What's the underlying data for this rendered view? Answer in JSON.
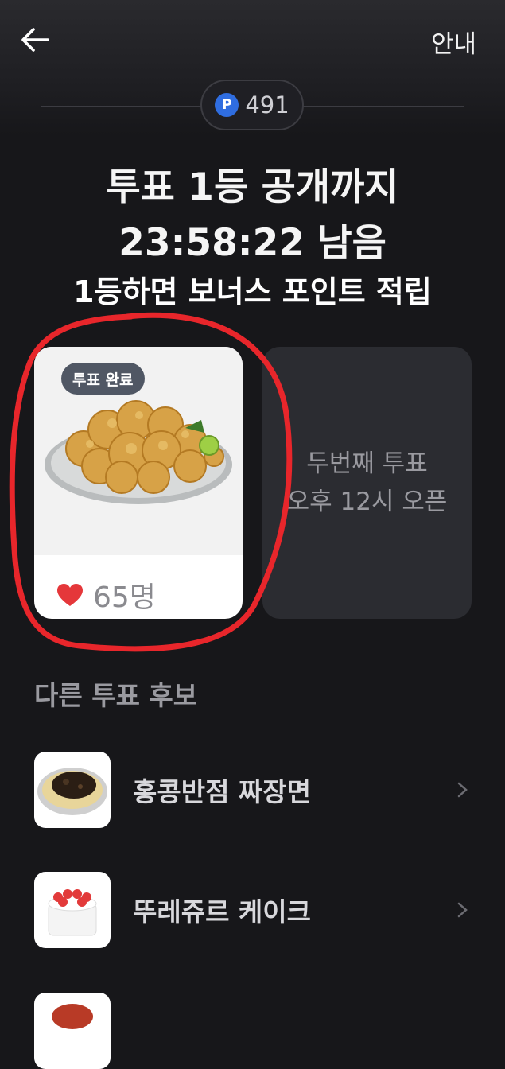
{
  "header": {
    "guide_label": "안내",
    "points": {
      "icon_letter": "P",
      "value": "491"
    }
  },
  "countdown": {
    "line1": "투표 1등 공개까지",
    "line2": "23:58:22 남음",
    "subtitle": "1등하면 보너스 포인트 적립"
  },
  "vote_card": {
    "badge": "투표 완료",
    "likes": "65명"
  },
  "second_vote": {
    "line1": "두번째 투표",
    "line2": "오후 12시 오픈"
  },
  "other_candidates": {
    "title": "다른 투표 후보",
    "items": [
      {
        "name": "홍콩반점 짜장면"
      },
      {
        "name": "뚜레쥬르 케이크"
      }
    ]
  },
  "colors": {
    "background": "#17171a",
    "accent_blue": "#2f6de0",
    "heart": "#e5373a",
    "annotation": "#e8262b"
  }
}
